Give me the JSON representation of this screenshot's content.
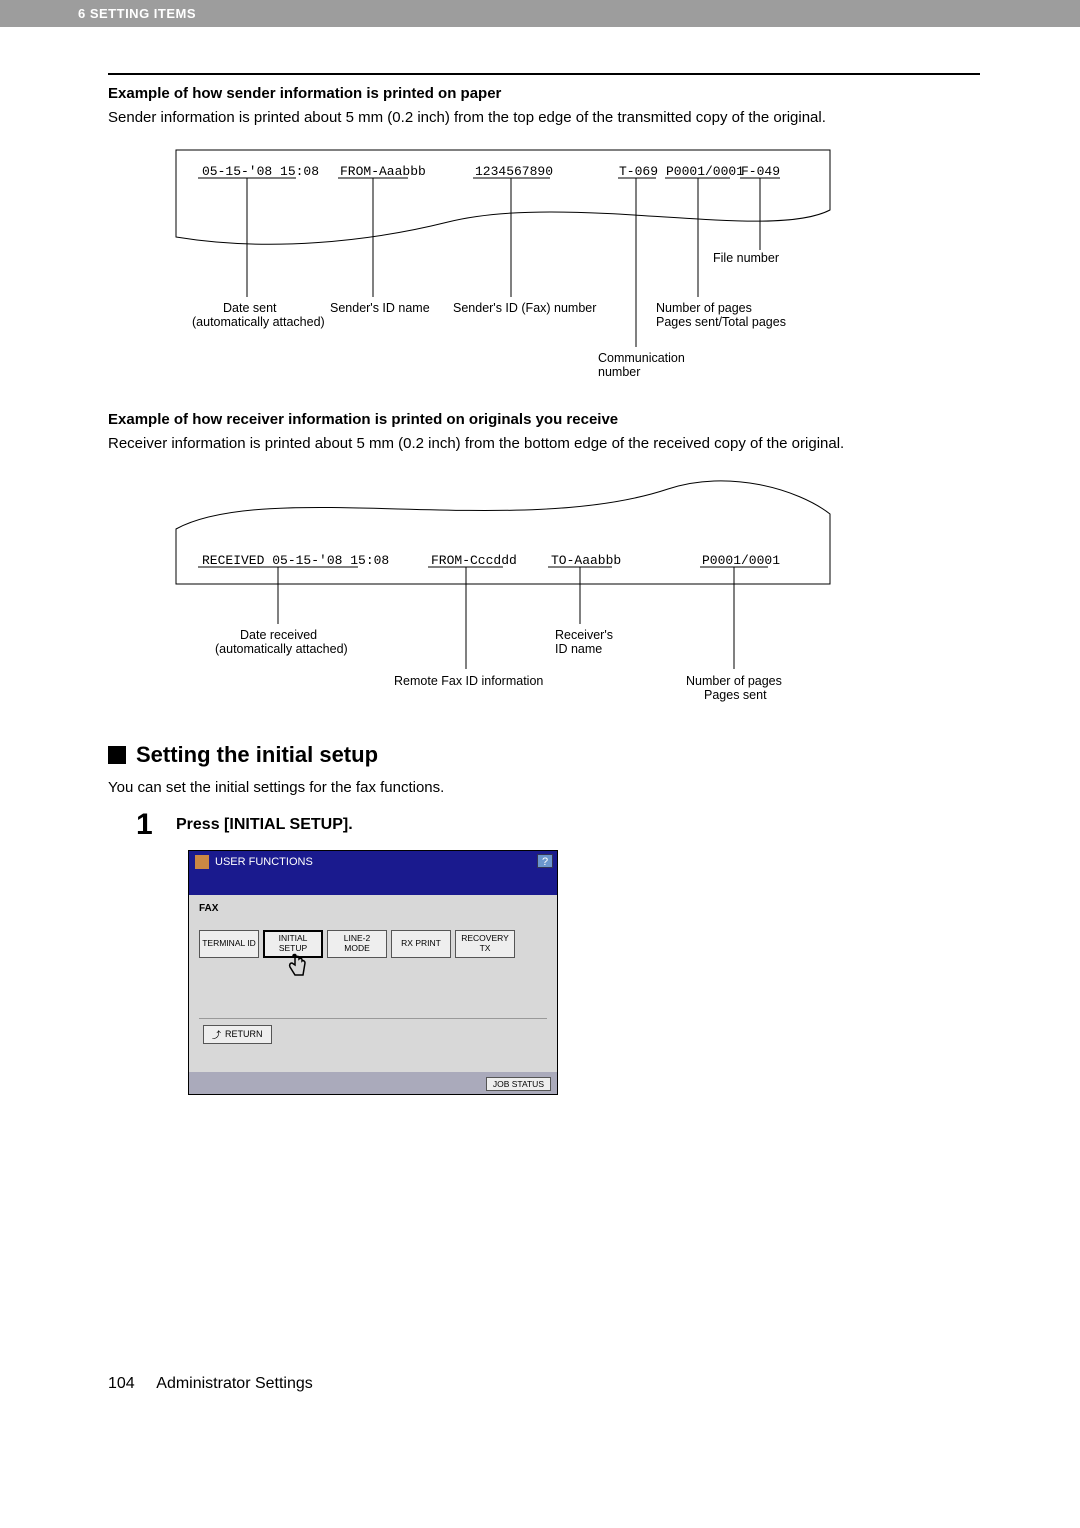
{
  "header": {
    "chapter": "6 SETTING ITEMS"
  },
  "section1": {
    "title": "Example of how sender information is printed on paper",
    "text": "Sender information is printed about 5 mm (0.2 inch) from the top edge of the transmitted copy of the original.",
    "diagram": {
      "fields": {
        "date": "05-15-'08 15:08",
        "from": "FROM-Aaabbb",
        "fax": "1234567890",
        "comm": "T-069",
        "pages": "P0001/0001",
        "file": "F-049"
      },
      "labels": {
        "file_number": "File number",
        "date_sent": "Date sent",
        "auto": "(automatically attached)",
        "sender_id_name": "Sender's ID name",
        "sender_id_fax": "Sender's ID (Fax) number",
        "num_pages": "Number of pages",
        "pages_ratio": "Pages sent/Total pages",
        "comm_number_l1": "Communication",
        "comm_number_l2": "number"
      }
    }
  },
  "section2": {
    "title": "Example of how receiver information is printed on originals you receive",
    "text": "Receiver information is printed about 5 mm (0.2 inch) from the bottom edge of the received copy of the original.",
    "diagram": {
      "fields": {
        "received": "RECEIVED 05-15-'08 15:08",
        "from": "FROM-Cccddd",
        "to": "TO-Aaabbb",
        "pages": "P0001/0001"
      },
      "labels": {
        "date_received": "Date received",
        "auto": "(automatically attached)",
        "remote_fax_id": "Remote Fax ID information",
        "receiver_id_l1": "Receiver's",
        "receiver_id_l2": "ID name",
        "num_pages": "Number of pages",
        "pages_sent": "Pages sent"
      }
    }
  },
  "setting": {
    "heading": "Setting the initial setup",
    "intro": "You can set the initial settings for the fax functions.",
    "step1_label": "Press [INITIAL SETUP].",
    "step1_num": "1"
  },
  "ui": {
    "title": "USER FUNCTIONS",
    "help": "?",
    "crumb": "FAX",
    "buttons": {
      "terminal_id": "TERMINAL ID",
      "initial_setup": "INITIAL SETUP",
      "line2": "LINE-2 MODE",
      "rx_print": "RX PRINT",
      "recovery_tx": "RECOVERY TX"
    },
    "return_label": "RETURN",
    "job_status": "JOB STATUS"
  },
  "footer": {
    "page": "104",
    "section": "Administrator Settings"
  }
}
